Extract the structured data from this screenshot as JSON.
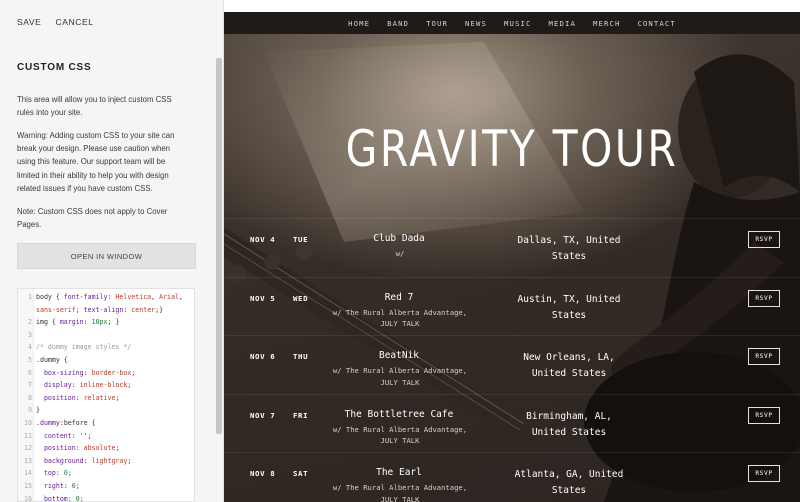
{
  "panel": {
    "save_label": "SAVE",
    "cancel_label": "CANCEL",
    "title": "CUSTOM CSS",
    "para1": "This area will allow you to inject custom CSS rules into your site.",
    "para2": "Warning: Adding custom CSS to your site can break your design. Please use caution when using this feature. Our support team will be limited in their ability to help you with design related issues if you have custom CSS.",
    "para3": "Note: Custom CSS does not apply to Cover Pages.",
    "open_window_label": "OPEN IN WINDOW"
  },
  "editor": {
    "lines": [
      {
        "num": "1",
        "text": "body { font-family: Helvetica, Arial,"
      },
      {
        "num": "",
        "text": "sans-serif; text-align: center;}"
      },
      {
        "num": "2",
        "text": "img { margin: 10px; }"
      },
      {
        "num": "3",
        "text": ""
      },
      {
        "num": "4",
        "text": "/* dummy image styles */"
      },
      {
        "num": "5",
        "text": ".dummy {"
      },
      {
        "num": "6",
        "text": "  box-sizing: border-box;"
      },
      {
        "num": "7",
        "text": "  display: inline-block;"
      },
      {
        "num": "8",
        "text": "  position: relative;"
      },
      {
        "num": "9",
        "text": "}"
      },
      {
        "num": "10",
        "text": ".dummy:before {"
      },
      {
        "num": "11",
        "text": "  content: '';"
      },
      {
        "num": "12",
        "text": "  position: absolute;"
      },
      {
        "num": "13",
        "text": "  background: lightgray;"
      },
      {
        "num": "14",
        "text": "  top: 0;"
      },
      {
        "num": "15",
        "text": "  right: 0;"
      },
      {
        "num": "16",
        "text": "  bottom: 0;"
      }
    ]
  },
  "nav": {
    "items": [
      "HOME",
      "BAND",
      "TOUR",
      "NEWS",
      "MUSIC",
      "MEDIA",
      "MERCH",
      "CONTACT"
    ]
  },
  "hero": {
    "title": "GRAVITY TOUR"
  },
  "tour": {
    "rsvp_label": "RSVP",
    "rows": [
      {
        "date": "NOV 4",
        "day": "TUE",
        "venue": "Club Dada",
        "support": "w/",
        "support2": "",
        "city1": "Dallas, TX, United",
        "city2": "States"
      },
      {
        "date": "NOV 5",
        "day": "WED",
        "venue": "Red 7",
        "support": "w/ The Rural Alberta Advantage,",
        "support2": "JULY TALK",
        "city1": "Austin, TX, United",
        "city2": "States"
      },
      {
        "date": "NOV 6",
        "day": "THU",
        "venue": "BeatNik",
        "support": "w/ The Rural Alberta Advantage,",
        "support2": "JULY TALK",
        "city1": "New Orleans, LA,",
        "city2": "United States"
      },
      {
        "date": "NOV 7",
        "day": "FRI",
        "venue": "The Bottletree Cafe",
        "support": "w/ The Rural Alberta Advantage,",
        "support2": "JULY TALK",
        "city1": "Birmingham, AL,",
        "city2": "United States"
      },
      {
        "date": "NOV 8",
        "day": "SAT",
        "venue": "The Earl",
        "support": "w/ The Rural Alberta Advantage,",
        "support2": "JULY TALK",
        "city1": "Atlanta, GA, United",
        "city2": "States"
      }
    ]
  }
}
